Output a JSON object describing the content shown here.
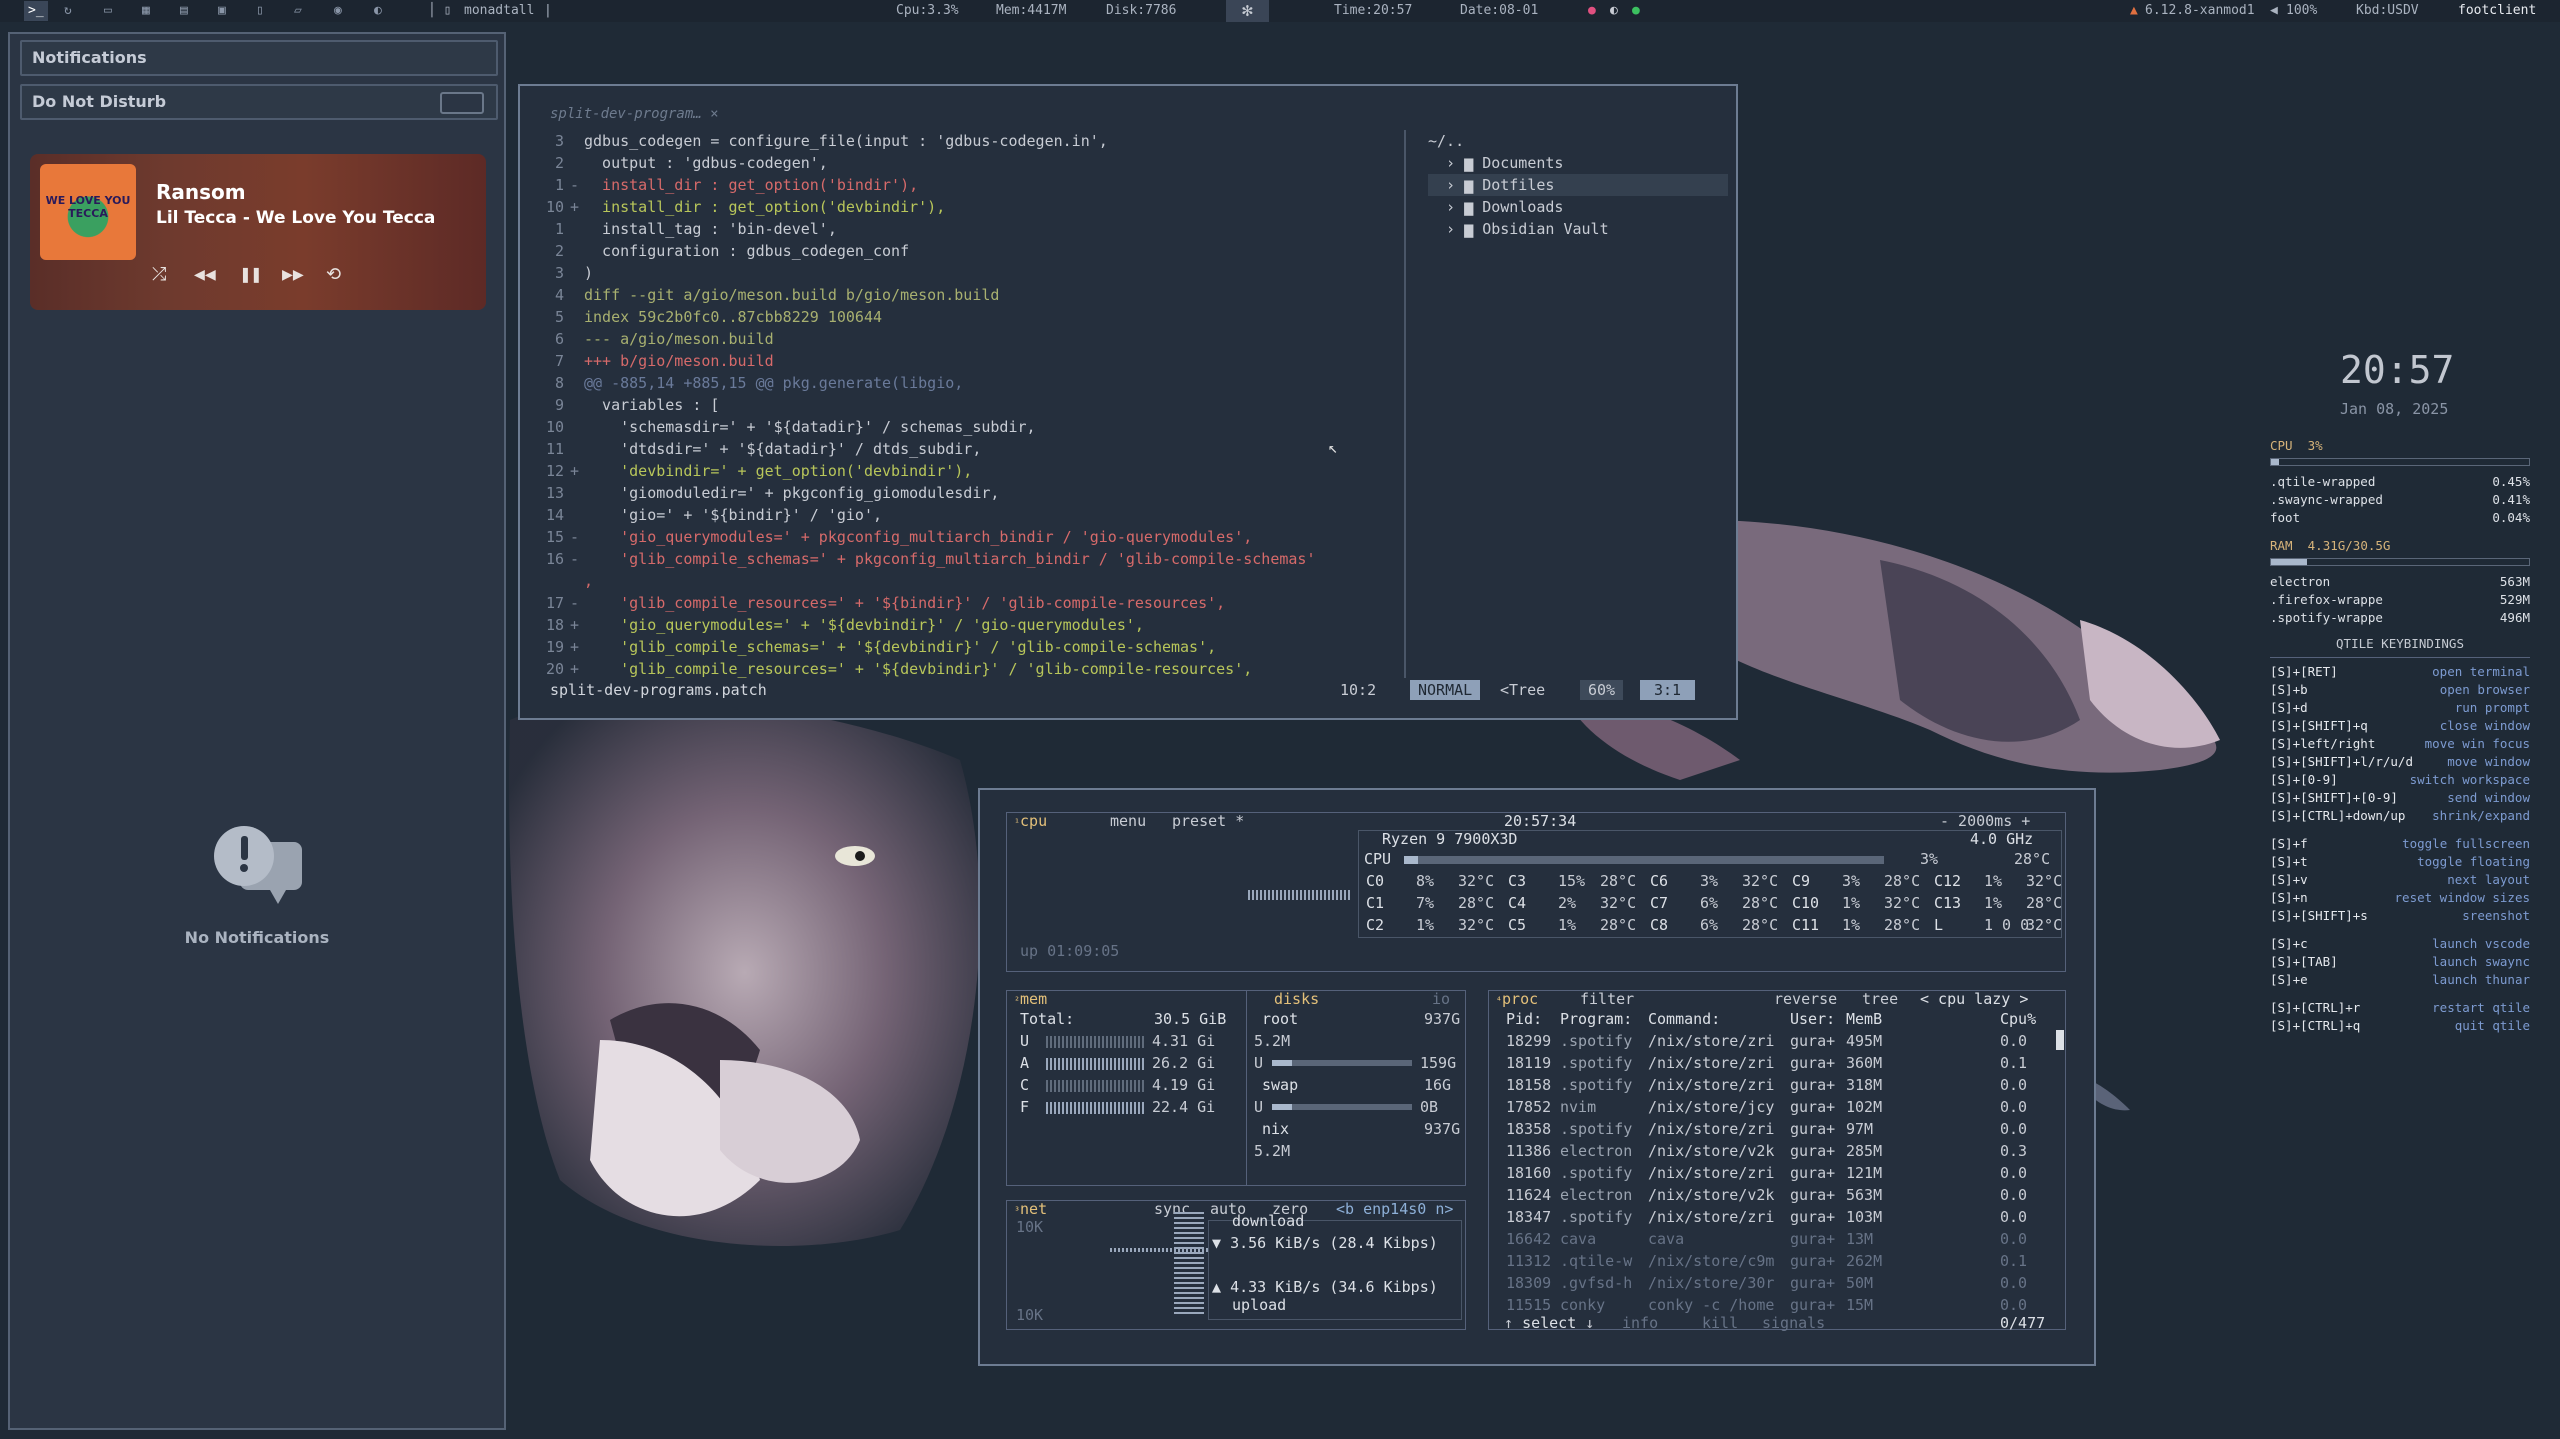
{
  "topbar": {
    "layout": "monadtall",
    "cpu": "Cpu:3.3%",
    "mem": "Mem:4417M",
    "disk": "Disk:7786",
    "time": "Time:20:57",
    "date": "Date:08-01",
    "kernel": "6.12.8-xanmod1",
    "volume": "100%",
    "kbd": "Kbd:USDV",
    "window": "footclient"
  },
  "notifications": {
    "title": "Notifications",
    "dnd": "Do Not Disturb",
    "empty": "No Notifications",
    "player": {
      "track": "Ransom",
      "artist": "Lil Tecca - We Love You Tecca",
      "cover_text": "WE LOVE YOU TECCA"
    }
  },
  "editor": {
    "tab": "split-dev-program…",
    "filename": "split-dev-programs.patch",
    "position": "10:2",
    "mode": "NORMAL",
    "tree_label": "<Tree",
    "percent": "60%",
    "cursor": "3:1",
    "code": [
      {
        "n": "3",
        "g": "",
        "t": "gdbus_codegen = configure_file(input : 'gdbus-codegen.in',",
        "c": "def"
      },
      {
        "n": "2",
        "g": "",
        "t": "  output : 'gdbus-codegen',",
        "c": "def"
      },
      {
        "n": "1",
        "g": "-",
        "t": "  install_dir : get_option('bindir'),",
        "c": "del"
      },
      {
        "n": "10",
        "g": "+",
        "t": "  install_dir : get_option('devbindir'),",
        "c": "add"
      },
      {
        "n": "1",
        "g": "",
        "t": "  install_tag : 'bin-devel',",
        "c": "def"
      },
      {
        "n": "2",
        "g": "",
        "t": "  configuration : gdbus_codegen_conf",
        "c": "def"
      },
      {
        "n": "3",
        "g": "",
        "t": ")",
        "c": "def"
      },
      {
        "n": "4",
        "g": "",
        "t": "diff --git a/gio/meson.build b/gio/meson.build",
        "c": "meta"
      },
      {
        "n": "5",
        "g": "",
        "t": "index 59c2b0fc0..87cbb8229 100644",
        "c": "meta"
      },
      {
        "n": "6",
        "g": "",
        "t": "--- a/gio/meson.build",
        "c": "meta"
      },
      {
        "n": "7",
        "g": "",
        "t": "+++ b/gio/meson.build",
        "c": "del"
      },
      {
        "n": "8",
        "g": "",
        "t": "@@ -885,14 +885,15 @@ pkg.generate(libgio,",
        "c": "hunk"
      },
      {
        "n": "9",
        "g": "",
        "t": "  variables : [",
        "c": "def"
      },
      {
        "n": "10",
        "g": "",
        "t": "    'schemasdir=' + '${datadir}' / schemas_subdir,",
        "c": "def"
      },
      {
        "n": "11",
        "g": "",
        "t": "    'dtdsdir=' + '${datadir}' / dtds_subdir,",
        "c": "def"
      },
      {
        "n": "12",
        "g": "+",
        "t": "    'devbindir=' + get_option('devbindir'),",
        "c": "add"
      },
      {
        "n": "13",
        "g": "",
        "t": "    'giomoduledir=' + pkgconfig_giomodulesdir,",
        "c": "def"
      },
      {
        "n": "14",
        "g": "",
        "t": "    'gio=' + '${bindir}' / 'gio',",
        "c": "def"
      },
      {
        "n": "15",
        "g": "-",
        "t": "    'gio_querymodules=' + pkgconfig_multiarch_bindir / 'gio-querymodules',",
        "c": "del"
      },
      {
        "n": "16",
        "g": "-",
        "t": "    'glib_compile_schemas=' + pkgconfig_multiarch_bindir / 'glib-compile-schemas'",
        "c": "del"
      },
      {
        "n": "",
        "g": "",
        "t": ",",
        "c": "del"
      },
      {
        "n": "17",
        "g": "-",
        "t": "    'glib_compile_resources=' + '${bindir}' / 'glib-compile-resources',",
        "c": "del"
      },
      {
        "n": "18",
        "g": "+",
        "t": "    'gio_querymodules=' + '${devbindir}' / 'gio-querymodules',",
        "c": "add"
      },
      {
        "n": "19",
        "g": "+",
        "t": "    'glib_compile_schemas=' + '${devbindir}' / 'glib-compile-schemas',",
        "c": "add"
      },
      {
        "n": "20",
        "g": "+",
        "t": "    'glib_compile_resources=' + '${devbindir}' / 'glib-compile-resources',",
        "c": "add"
      }
    ],
    "tree": {
      "root": "~/..",
      "items": [
        "Documents",
        "Dotfiles",
        "Downloads",
        "Obsidian Vault"
      ],
      "selected": 1
    }
  },
  "clock": {
    "time": "20:57",
    "date": "Jan 08, 2025"
  },
  "sysmon": {
    "cpu_label": "CPU",
    "cpu_pct_label": "3%",
    "cpu_pct": 3,
    "cpu_procs": [
      {
        "name": ".qtile-wrapped",
        "val": "0.45%"
      },
      {
        "name": ".swaync-wrapped",
        "val": "0.41%"
      },
      {
        "name": "foot",
        "val": "0.04%"
      }
    ],
    "ram_label": "RAM",
    "ram_value": "4.31G/30.5G",
    "ram_pct": 14,
    "ram_procs": [
      {
        "name": "electron",
        "val": "563M"
      },
      {
        "name": ".firefox-wrappe",
        "val": "529M"
      },
      {
        "name": ".spotify-wrappe",
        "val": "496M"
      }
    ],
    "kb_title": "QTILE KEYBINDINGS",
    "kb_groups": [
      [
        {
          "k": "[S]+[RET]",
          "d": "open terminal"
        },
        {
          "k": "[S]+b",
          "d": "open browser"
        },
        {
          "k": "[S]+d",
          "d": "run prompt"
        },
        {
          "k": "[S]+[SHIFT]+q",
          "d": "close window"
        },
        {
          "k": "[S]+left/right",
          "d": "move win focus"
        },
        {
          "k": "[S]+[SHIFT]+l/r/u/d",
          "d": "move window"
        },
        {
          "k": "[S]+[0-9]",
          "d": "switch workspace"
        },
        {
          "k": "[S]+[SHIFT]+[0-9]",
          "d": "send window"
        },
        {
          "k": "[S]+[CTRL]+down/up",
          "d": "shrink/expand"
        }
      ],
      [
        {
          "k": "[S]+f",
          "d": "toggle fullscreen"
        },
        {
          "k": "[S]+t",
          "d": "toggle floating"
        },
        {
          "k": "[S]+v",
          "d": "next layout"
        },
        {
          "k": "[S]+n",
          "d": "reset window sizes"
        },
        {
          "k": "[S]+[SHIFT]+s",
          "d": "sreenshot"
        }
      ],
      [
        {
          "k": "[S]+c",
          "d": "launch vscode"
        },
        {
          "k": "[S]+[TAB]",
          "d": "launch swaync"
        },
        {
          "k": "[S]+e",
          "d": "launch thunar"
        }
      ],
      [
        {
          "k": "[S]+[CTRL]+r",
          "d": "restart qtile"
        },
        {
          "k": "[S]+[CTRL]+q",
          "d": "quit qtile"
        }
      ]
    ]
  },
  "btop": {
    "cpu_title": "cpu",
    "menu": "menu",
    "preset": "preset *",
    "clock": "20:57:34",
    "interval": "- 2000ms +",
    "cpu_model": "Ryzen 9 7900X3D",
    "freq": "4.0 GHz",
    "cpu_total": "3%",
    "cpu_temp": "28°C",
    "uptime": "up 01:09:05",
    "cores": [
      [
        "C0",
        "8%",
        "32°C",
        "C3",
        "15%",
        "28°C",
        "C6",
        "3%",
        "32°C",
        "C9",
        "3%",
        "28°C",
        "C12",
        "1%",
        "32°C"
      ],
      [
        "C1",
        "7%",
        "28°C",
        "C4",
        "2%",
        "32°C",
        "C7",
        "6%",
        "28°C",
        "C10",
        "1%",
        "32°C",
        "C13",
        "1%",
        "28°C"
      ],
      [
        "C2",
        "1%",
        "32°C",
        "C5",
        "1%",
        "28°C",
        "C8",
        "6%",
        "28°C",
        "C11",
        "1%",
        "28°C",
        "L",
        "1 0 0",
        "32°C"
      ]
    ],
    "mem_title": "mem",
    "mem_total_label": "Total:",
    "mem_total": "30.5 GiB",
    "mem_rows": [
      {
        "k": "U",
        "v": "4.31 Gi"
      },
      {
        "k": "A",
        "v": "26.2 Gi"
      },
      {
        "k": "C",
        "v": "4.19 Gi"
      },
      {
        "k": "F",
        "v": "22.4 Gi"
      }
    ],
    "disks_title": "disks",
    "io": "io",
    "disks": [
      {
        "name": "root",
        "size": "937G",
        "sub": "5.2M",
        "u": "U",
        "used": "159G"
      },
      {
        "name": "swap",
        "size": "16G",
        "sub": "",
        "u": "U",
        "used": "0B"
      },
      {
        "name": "nix",
        "size": "937G",
        "sub": "5.2M",
        "u": "",
        "used": ""
      }
    ],
    "net_title": "net",
    "net_sync": "sync",
    "net_auto": "auto",
    "net_zero": "zero",
    "net_iface": "<b enp14s0 n>",
    "net_scale_top": "10K",
    "net_scale_bot": "10K",
    "download_label": "download",
    "download": "3.56 KiB/s (28.4 Kibps)",
    "upload": "4.33 KiB/s (34.6 Kibps)",
    "upload_label": "upload",
    "proc_title": "proc",
    "proc_filter": "filter",
    "proc_reverse": "reverse",
    "proc_tree": "tree",
    "proc_sort": "< cpu lazy >",
    "proc_headers": [
      "Pid:",
      "Program:",
      "Command:",
      "User:",
      "MemB",
      "Cpu%"
    ],
    "procs": [
      [
        "18299",
        ".spotify",
        "/nix/store/zri",
        "gura+",
        "495M",
        "0.0"
      ],
      [
        "18119",
        ".spotify",
        "/nix/store/zri",
        "gura+",
        "360M",
        "0.1"
      ],
      [
        "18158",
        ".spotify",
        "/nix/store/zri",
        "gura+",
        "318M",
        "0.0"
      ],
      [
        "17852",
        "nvim",
        "/nix/store/jcy",
        "gura+",
        "102M",
        "0.0"
      ],
      [
        "18358",
        ".spotify",
        "/nix/store/zri",
        "gura+",
        "97M",
        "0.0"
      ],
      [
        "11386",
        "electron",
        "/nix/store/v2k",
        "gura+",
        "285M",
        "0.3"
      ],
      [
        "18160",
        ".spotify",
        "/nix/store/zri",
        "gura+",
        "121M",
        "0.0"
      ],
      [
        "11624",
        "electron",
        "/nix/store/v2k",
        "gura+",
        "563M",
        "0.0"
      ],
      [
        "18347",
        ".spotify",
        "/nix/store/zri",
        "gura+",
        "103M",
        "0.0"
      ],
      [
        "16642",
        "cava",
        "cava",
        "gura+",
        "13M",
        "0.0"
      ],
      [
        "11312",
        ".qtile-w",
        "/nix/store/c9m",
        "gura+",
        "262M",
        "0.1"
      ],
      [
        "18309",
        ".gvfsd-h",
        "/nix/store/30r",
        "gura+",
        "50M",
        "0.0"
      ],
      [
        "11515",
        "conky",
        "conky -c /home",
        "gura+",
        "15M",
        "0.0"
      ]
    ],
    "proc_footer": "select",
    "proc_info": "info",
    "proc_kill": "kill",
    "proc_signals": "signals",
    "proc_count": "0/477"
  },
  "colors": {
    "accent": "#e3c07a",
    "panel_bg": "#2b3544",
    "border": "#6d7c92",
    "mode_bg": "#8ea0b8"
  }
}
